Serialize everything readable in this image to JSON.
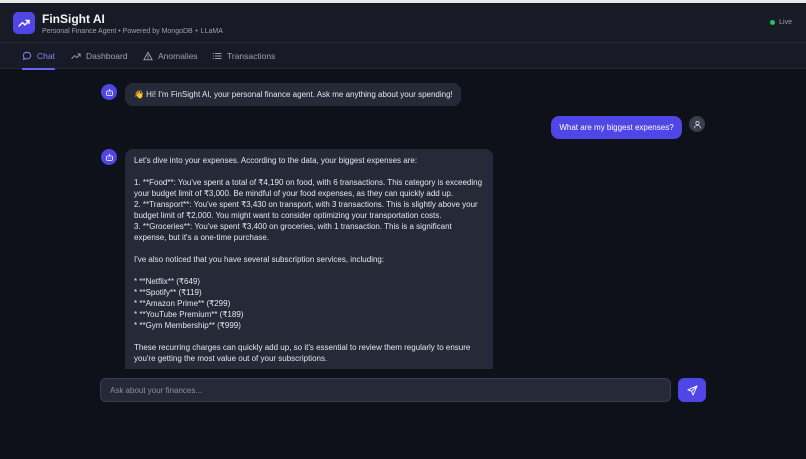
{
  "app": {
    "title": "FinSight AI",
    "subtitle": "Personal Finance Agent • Powered by MongoDB + LLaMA",
    "status": "Live",
    "status_color": "#22c55e",
    "accent": "#4f46e5"
  },
  "tabs": [
    {
      "label": "Chat",
      "icon": "chat-bubble-icon",
      "active": true
    },
    {
      "label": "Dashboard",
      "icon": "trend-up-icon",
      "active": false
    },
    {
      "label": "Anomalies",
      "icon": "warning-triangle-icon",
      "active": false
    },
    {
      "label": "Transactions",
      "icon": "list-icon",
      "active": false
    }
  ],
  "messages": [
    {
      "role": "bot",
      "lines": [
        "👋 Hi! I'm FinSight AI, your personal finance agent. Ask me anything about your spending!"
      ]
    },
    {
      "role": "user",
      "lines": [
        "What are my biggest expenses?"
      ]
    },
    {
      "role": "bot",
      "lines": [
        "Let's dive into your expenses. According to the data, your biggest expenses are:",
        "",
        "1. **Food**: You've spent a total of ₹4,190 on food, with 6 transactions. This category is exceeding",
        "your budget limit of ₹3,000. Be mindful of your food expenses, as they can quickly add up.",
        "2. **Transport**: You've spent ₹3,430 on transport, with 3 transactions. This is slightly above your",
        "budget limit of ₹2,000. You might want to consider optimizing your transportation costs.",
        "3. **Groceries**: You've spent ₹3,400 on groceries, with 1 transaction. This is a significant",
        "expense, but it's a one-time purchase.",
        "",
        "I've also noticed that you have several subscription services, including:",
        "",
        "* **Netflix** (₹649)",
        "* **Spotify** (₹119)",
        "* **Amazon Prime** (₹299)",
        "* **YouTube Premium** (₹189)",
        "* **Gym Membership** (₹999)",
        "",
        "These recurring charges can quickly add up, so it's essential to review them regularly to ensure",
        "you're getting the most value out of your subscriptions."
      ]
    }
  ],
  "composer": {
    "placeholder": "Ask about your finances...",
    "send_icon": "send-icon"
  }
}
